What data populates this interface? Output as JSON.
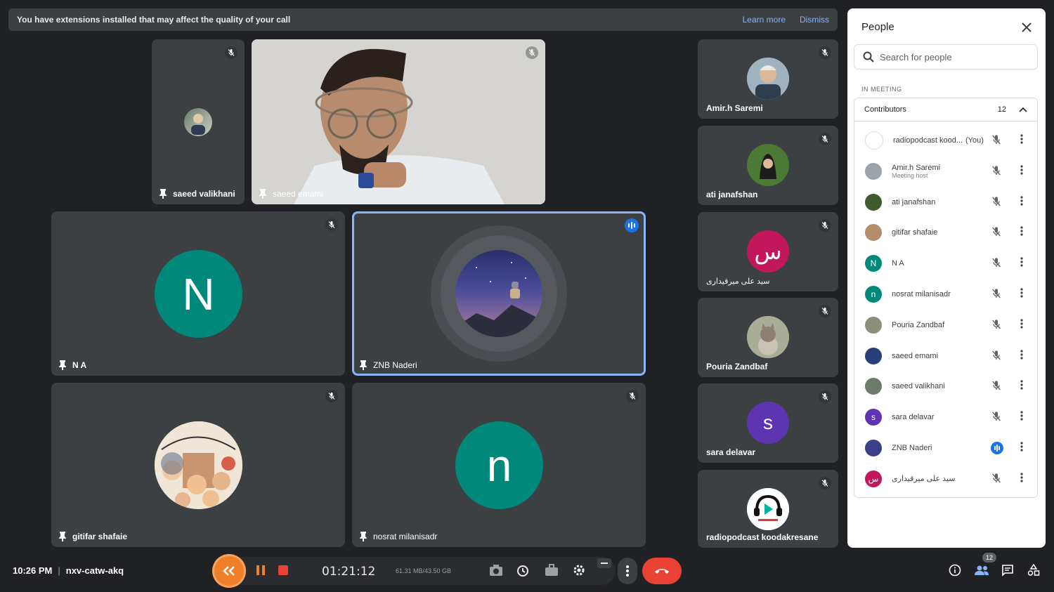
{
  "banner": {
    "message": "You have extensions installed that may affect the quality of your call",
    "learn_more": "Learn more",
    "dismiss": "Dismiss"
  },
  "tiles": {
    "saeed_valikhani": "saeed valikhani",
    "saeed_emami": "saeed emami",
    "na": "N A",
    "na_initial": "N",
    "znb": "ZNB Naderi",
    "gitifar": "gitifar shafaie",
    "nosrat": "nosrat milanisadr",
    "nosrat_initial": "n",
    "amir": "Amir.h Saremi",
    "ati": "ati janafshan",
    "seyed": "سید علی میرقیداری",
    "seyed_initial": "س",
    "pouria": "Pouria Zandbaf",
    "sara": "sara delavar",
    "sara_initial": "s",
    "radio": "radiopodcast koodakresane"
  },
  "panel": {
    "title": "People",
    "search_placeholder": "Search for people",
    "section": "IN MEETING",
    "group": "Contributors",
    "group_count": "12",
    "you_label": "(You)",
    "participants": [
      {
        "name": "radiopodcast kood...",
        "sub": "",
        "initial": "",
        "color": "#ffffff"
      },
      {
        "name": "Amir.h Saremi",
        "sub": "Meeting host",
        "initial": "",
        "color": "#9ca3aa"
      },
      {
        "name": "ati janafshan",
        "sub": "",
        "initial": "",
        "color": "#3e5a2e"
      },
      {
        "name": "gitifar shafaie",
        "sub": "",
        "initial": "",
        "color": "#b28f6a"
      },
      {
        "name": "N A",
        "sub": "",
        "initial": "N",
        "color": "#00897b"
      },
      {
        "name": "nosrat milanisadr",
        "sub": "",
        "initial": "n",
        "color": "#00897b"
      },
      {
        "name": "Pouria Zandbaf",
        "sub": "",
        "initial": "",
        "color": "#8b8f7a"
      },
      {
        "name": "saeed emami",
        "sub": "",
        "initial": "",
        "color": "#2a3f7a"
      },
      {
        "name": "saeed valikhani",
        "sub": "",
        "initial": "",
        "color": "#6c7b6a"
      },
      {
        "name": "sara delavar",
        "sub": "",
        "initial": "s",
        "color": "#5e35b1"
      },
      {
        "name": "ZNB Naderi",
        "sub": "",
        "initial": "",
        "color": "#3a3f8a"
      },
      {
        "name": "سید علی میرقیداری",
        "sub": "",
        "initial": "س",
        "color": "#c2185b"
      }
    ]
  },
  "bottom": {
    "time": "10:26 PM",
    "meeting_code": "nxv-catw-akq",
    "recorder_time": "01:21:12",
    "storage": "61.31 MB/43.50 GB",
    "people_count": "12"
  },
  "colors": {
    "background": "#202124",
    "tile": "#3c4043",
    "accent": "#8ab4f8",
    "hangup": "#ea4335",
    "recorder": "#f07f2a"
  }
}
